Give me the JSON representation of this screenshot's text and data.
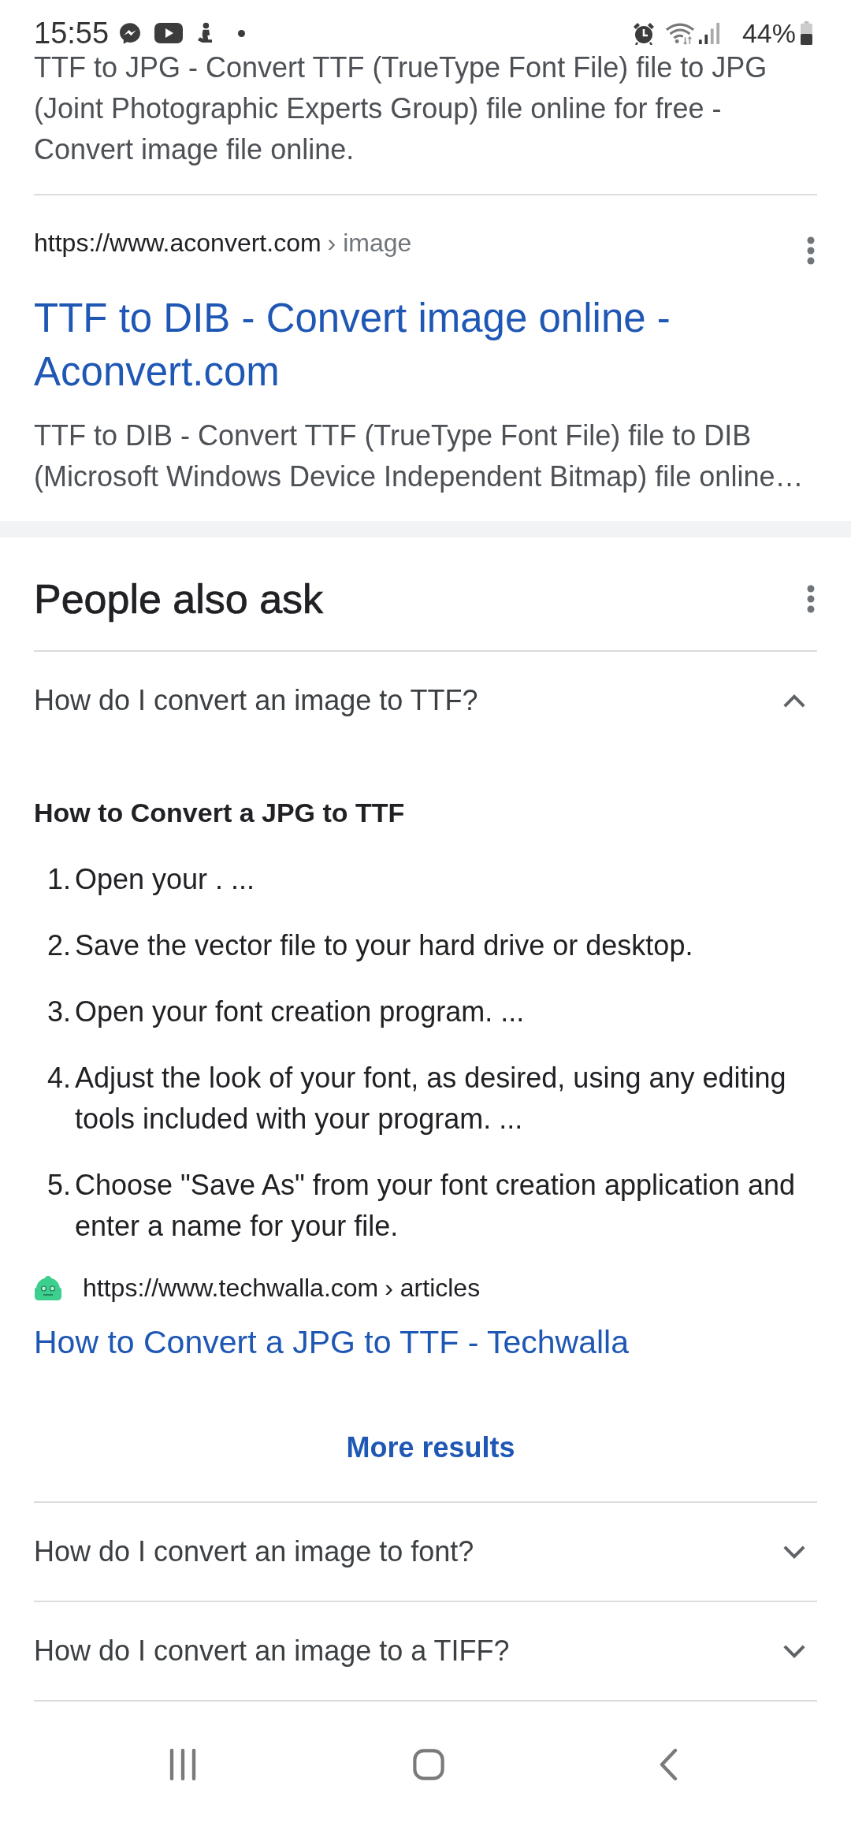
{
  "status_bar": {
    "time": "15:55",
    "battery": "44%"
  },
  "previous_result": {
    "snippet": "TTF to JPG - Convert TTF (TrueType Font File) file to JPG (Joint Photographic Experts Group) file online for free - Convert image file online."
  },
  "result": {
    "url": "https://www.aconvert.com",
    "breadcrumb": "› image",
    "title": "TTF to DIB - Convert image online - Aconvert.com",
    "snippet": "TTF to DIB - Convert TTF (TrueType Font File) file to DIB (Microsoft Windows Device Independent Bitmap) file online…"
  },
  "people_also_ask": {
    "title": "People also ask",
    "questions": [
      {
        "question": "How do I convert an image to TTF?",
        "expanded": true,
        "answer": {
          "heading": "How to Convert a JPG to TTF",
          "steps": [
            {
              "number": "1.",
              "text": "Open your . ..."
            },
            {
              "number": "2.",
              "text": "Save the vector file to your hard drive or desktop."
            },
            {
              "number": "3.",
              "text": "Open your font creation program. ..."
            },
            {
              "number": "4.",
              "text": "Adjust the look of your font, as desired, using any editing tools included with your program. ..."
            },
            {
              "number": "5.",
              "text": "Choose \"Save As\" from your font creation application and enter a name for your file."
            }
          ],
          "source": {
            "url": "https://www.techwalla.com",
            "breadcrumb": "› articles",
            "title": "How to Convert a JPG to TTF - Techwalla"
          },
          "more_results": "More results"
        }
      },
      {
        "question": "How do I convert an image to font?",
        "expanded": false
      },
      {
        "question": "How do I convert an image to a TIFF?",
        "expanded": false
      }
    ]
  }
}
